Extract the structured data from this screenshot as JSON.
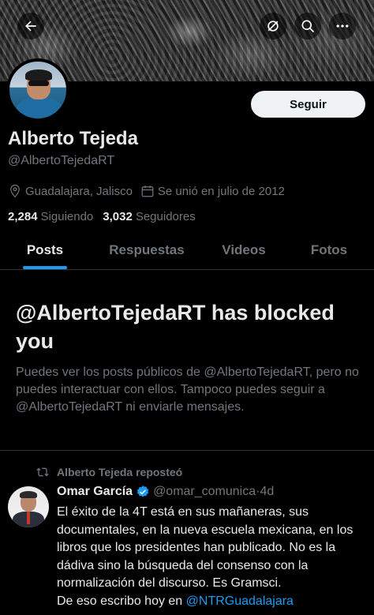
{
  "header": {
    "back_icon": "arrow-left-icon",
    "grok_icon": "grok-icon",
    "search_icon": "search-icon",
    "more_icon": "more-icon"
  },
  "profile": {
    "name": "Alberto Tejeda",
    "handle": "@AlbertoTejedaRT",
    "follow_label": "Seguir",
    "location": "Guadalajara, Jalisco",
    "joined": "Se unió en julio de 2012",
    "following_count": "2,284",
    "following_label": "Siguiendo",
    "followers_count": "3,032",
    "followers_label": "Seguidores"
  },
  "tabs": [
    {
      "label": "Posts"
    },
    {
      "label": "Respuestas"
    },
    {
      "label": "Videos"
    },
    {
      "label": "Fotos"
    }
  ],
  "blocked": {
    "title": "@AlbertoTejedaRT has blocked you",
    "description": "Puedes ver los posts públicos de @AlbertoTejedaRT, pero no puedes interactuar con ellos. Tampoco puedes seguir a @AlbertoTejedaRT ni enviarle mensajes."
  },
  "post": {
    "repost_label": "Alberto Tejeda reposteó",
    "author_name": "Omar García",
    "author_handle": "@omar_comunica",
    "separator": "·",
    "time": "4d",
    "body_text": "El éxito de la 4T está en sus mañaneras, sus documentales, en la nueva escuela mexicana, en los libros que los presidentes han publicado. No es la dádiva sino la búsqueda del consenso con la normalización del discurso. Es Gramsci.",
    "body_line2_prefix": "De eso escribo hoy en ",
    "body_mention": "@NTRGuadalajara"
  },
  "colors": {
    "accent": "#1d9bf0",
    "muted": "#71767b",
    "text": "#e7e9ea",
    "background": "#000000"
  }
}
